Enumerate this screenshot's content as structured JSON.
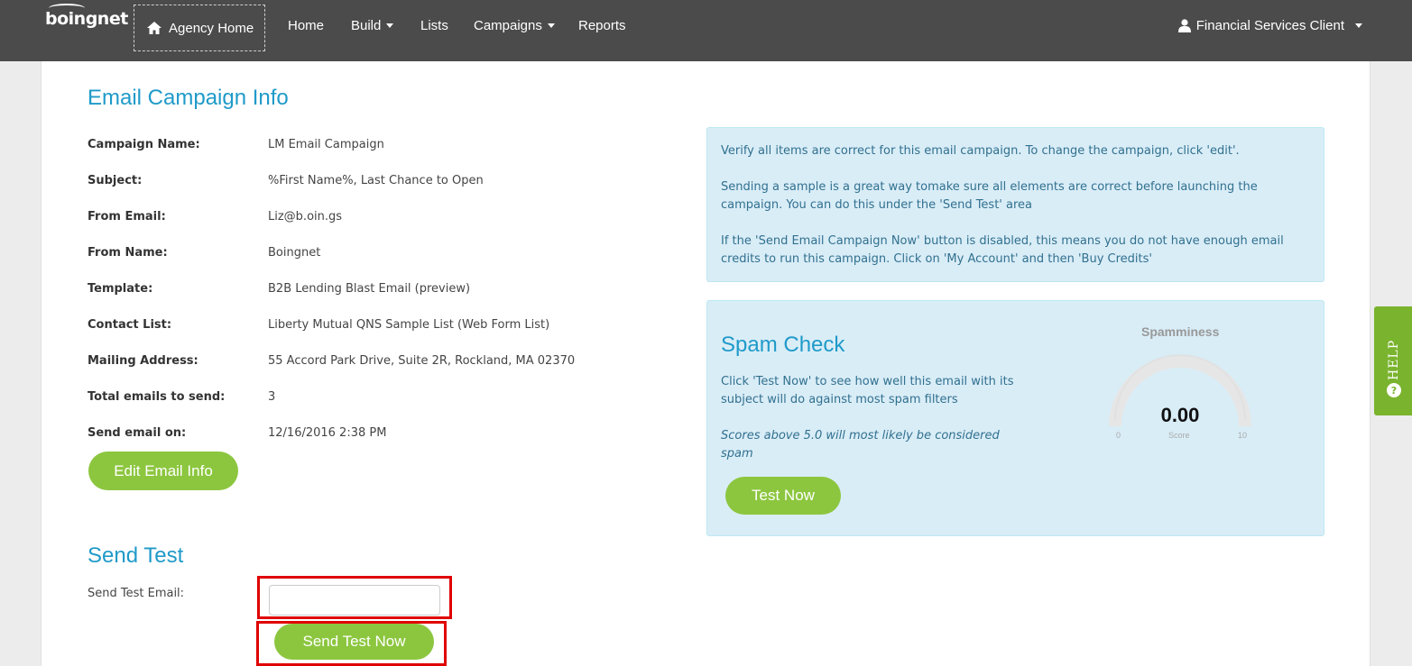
{
  "nav": {
    "logo": "boingnet",
    "agency_home": "Agency Home",
    "items": [
      "Home",
      "Build",
      "Lists",
      "Campaigns",
      "Reports"
    ],
    "user": "Financial Services Client"
  },
  "info": {
    "title": "Email Campaign Info",
    "rows": [
      {
        "label": "Campaign Name:",
        "value": "LM Email Campaign"
      },
      {
        "label": "Subject:",
        "value": "%First Name%, Last Chance to Open"
      },
      {
        "label": "From Email:",
        "value": "Liz@b.oin.gs"
      },
      {
        "label": "From Name:",
        "value": "Boingnet"
      },
      {
        "label": "Template:",
        "value": "B2B Lending Blast Email (preview)"
      },
      {
        "label": "Contact List:",
        "value": "Liberty Mutual QNS Sample List (Web Form List)"
      },
      {
        "label": "Mailing Address:",
        "value": "55 Accord Park Drive, Suite 2R, Rockland, MA 02370"
      },
      {
        "label": "Total emails to send:",
        "value": "3"
      },
      {
        "label": "Send email on:",
        "value": "12/16/2016 2:38 PM"
      }
    ],
    "edit_button": "Edit Email Info"
  },
  "notice": {
    "p1": "Verify all items are correct for this email campaign. To change the campaign, click 'edit'.",
    "p2": "Sending a sample is a great way tomake sure all elements are correct before launching the campaign. You can do this under the 'Send Test' area",
    "p3": "If the 'Send Email Campaign Now' button is disabled, this means you do not have enough email credits to run this campaign. Click on 'My Account' and then 'Buy Credits'"
  },
  "spam": {
    "title": "Spam Check",
    "desc": "Click 'Test Now' to see how well this email with its subject will do against most spam filters",
    "note": "Scores above 5.0 will most likely be considered spam",
    "button": "Test Now",
    "gauge_title": "Spamminess",
    "score": "0.00",
    "score_label": "Score",
    "min": "0",
    "max": "10"
  },
  "send_test": {
    "title": "Send Test",
    "label": "Send Test Email:",
    "input_value": "",
    "button": "Send Test Now"
  },
  "help": {
    "label": "HELP"
  },
  "colors": {
    "navbar": "#4b4b4b",
    "accent_blue": "#1f9ac9",
    "green": "#8cc63f",
    "info_bg": "#d9edf7",
    "highlight_red": "#e00000"
  }
}
